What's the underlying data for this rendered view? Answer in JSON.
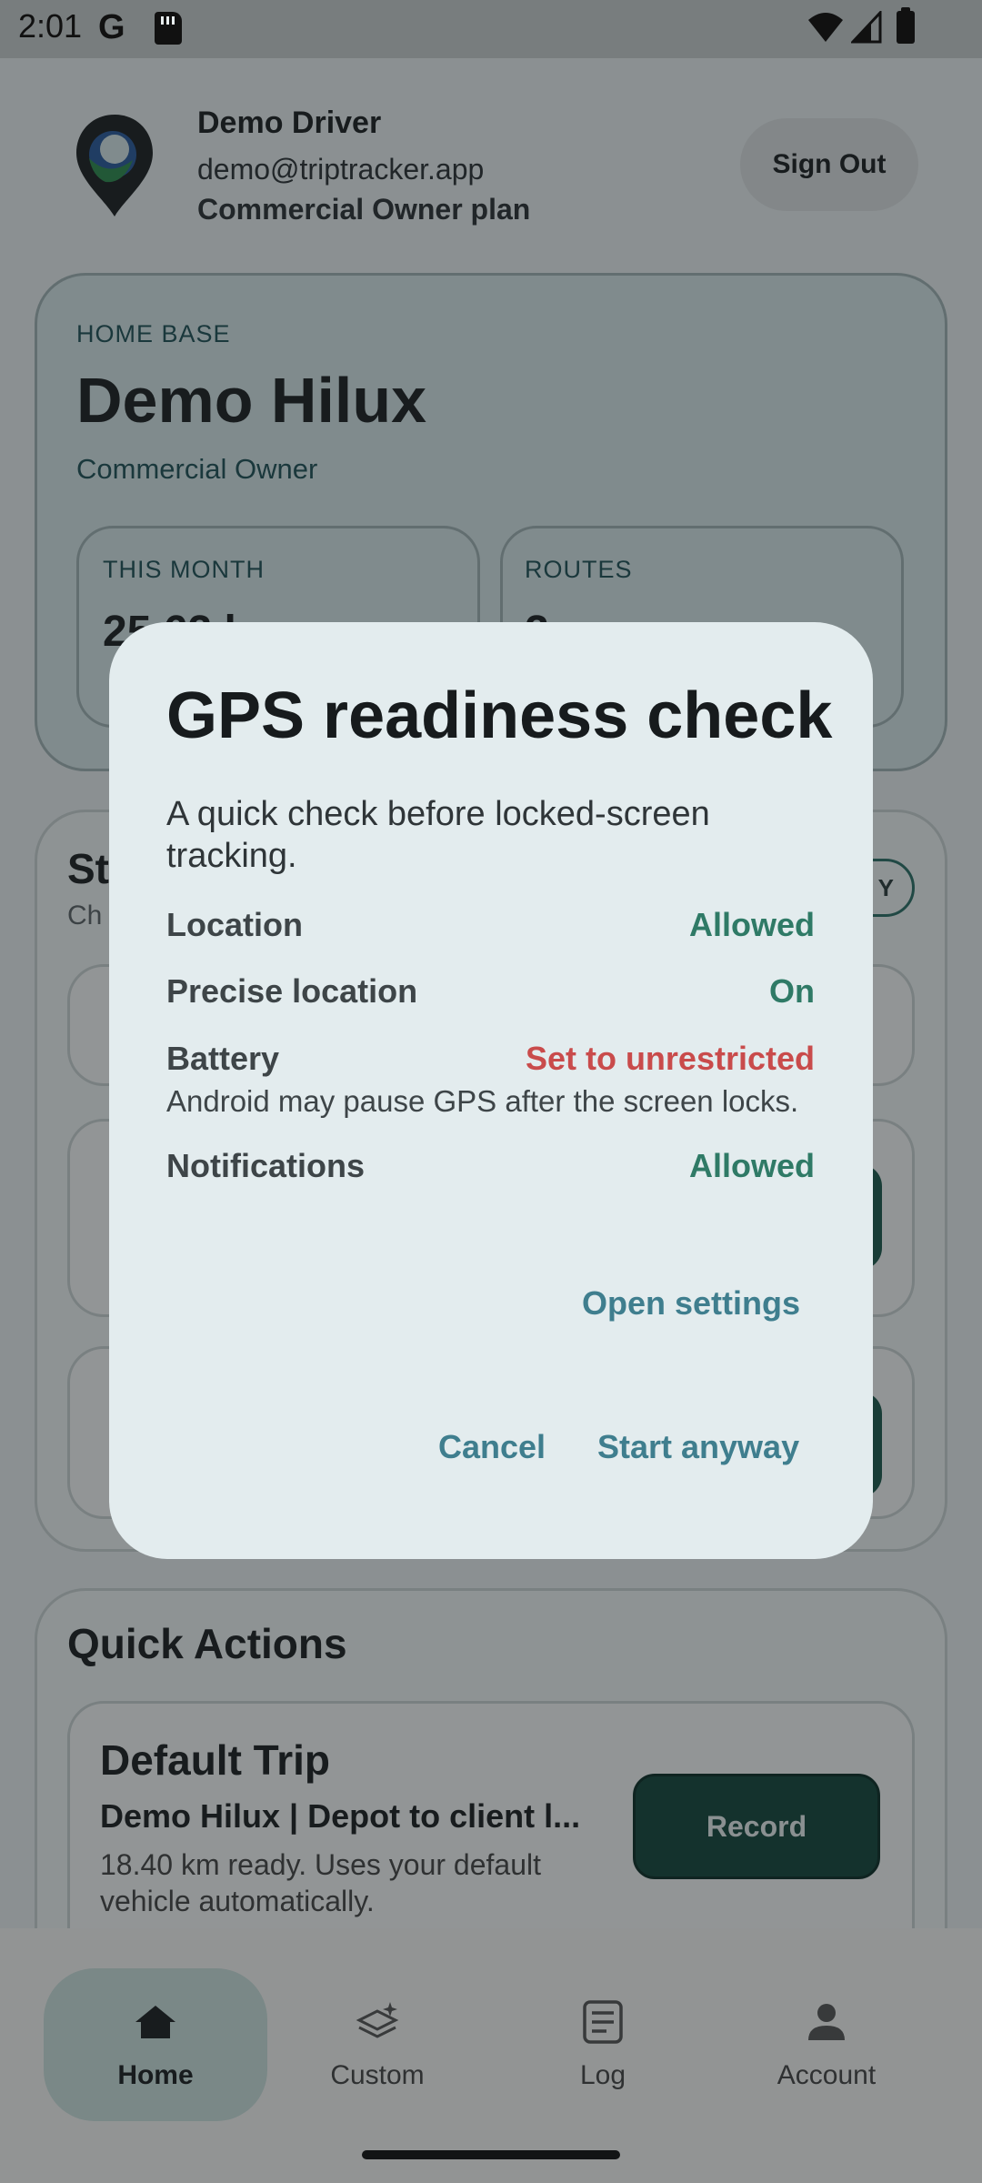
{
  "status_bar": {
    "time": "2:01",
    "google_icon": "G"
  },
  "header": {
    "user_name": "Demo Driver",
    "user_email": "demo@triptracker.app",
    "plan": "Commercial Owner plan",
    "sign_out_label": "Sign Out"
  },
  "home_card": {
    "eyebrow": "HOME BASE",
    "vehicle": "Demo Hilux",
    "role": "Commercial Owner",
    "stats": [
      {
        "label": "THIS MONTH",
        "value": "25.62 km"
      },
      {
        "label": "ROUTES",
        "value": "2"
      }
    ]
  },
  "start_card": {
    "title": "St",
    "subtitle": "Ch",
    "verify_label": "Y"
  },
  "quick_actions": {
    "title": "Quick Actions",
    "trip": {
      "title": "Default Trip",
      "route": "Demo Hilux | Depot to client l...",
      "description": "18.40 km ready. Uses your default vehicle automatically.",
      "record_label": "Record"
    }
  },
  "nav": {
    "items": [
      {
        "label": "Home",
        "icon": "home-icon"
      },
      {
        "label": "Custom",
        "icon": "custom-trip-icon"
      },
      {
        "label": "Log",
        "icon": "log-icon"
      },
      {
        "label": "Account",
        "icon": "account-icon"
      }
    ]
  },
  "dialog": {
    "title": "GPS readiness check",
    "body": "A quick check before locked-screen tracking.",
    "checks": [
      {
        "label": "Location",
        "value": "Allowed",
        "status": "ok"
      },
      {
        "label": "Precise location",
        "value": "On",
        "status": "ok"
      },
      {
        "label": "Battery",
        "value": "Set to unrestricted",
        "status": "warn"
      },
      {
        "label": "Notifications",
        "value": "Allowed",
        "status": "ok"
      }
    ],
    "battery_note": "Android may pause GPS after the screen locks.",
    "open_settings_label": "Open settings",
    "cancel_label": "Cancel",
    "start_anyway_label": "Start anyway"
  },
  "colors": {
    "accent": "#2f7a66",
    "warning": "#c94b4b",
    "dialog_button": "#3f7e8e",
    "primary_button": "#14463c"
  }
}
